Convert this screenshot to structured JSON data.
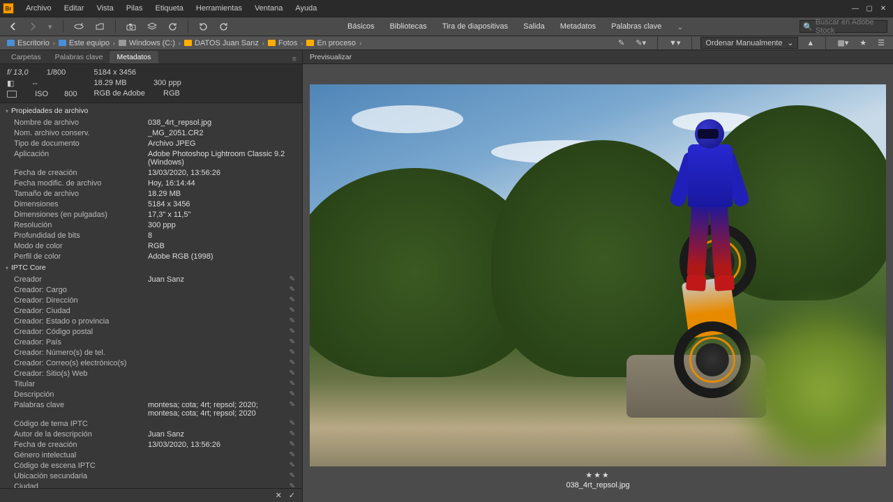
{
  "app_icon_text": "Br",
  "menu": [
    "Archivo",
    "Editar",
    "Vista",
    "Pilas",
    "Etiqueta",
    "Herramientas",
    "Ventana",
    "Ayuda"
  ],
  "toolbar_links": [
    "Básicos",
    "Bibliotecas",
    "Tira de diapositivas",
    "Salida",
    "Metadatos",
    "Palabras clave"
  ],
  "search_placeholder": "Buscar en Adobe Stock",
  "breadcrumb": [
    {
      "icon": "pc",
      "label": "Escritorio"
    },
    {
      "icon": "pc",
      "label": "Este equipo"
    },
    {
      "icon": "drive",
      "label": "Windows (C:)"
    },
    {
      "icon": "folder",
      "label": "DATOS Juan Sanz"
    },
    {
      "icon": "folder",
      "label": "Fotos"
    },
    {
      "icon": "folder",
      "label": "En proceso",
      "last": true
    }
  ],
  "sort_label": "Ordenar Manualmente",
  "panel_tabs": [
    "Carpetas",
    "Palabras clave",
    "Metadatos"
  ],
  "active_panel_tab": 2,
  "preview_label": "Previsualizar",
  "exif": {
    "fstop": "f/ 13,0",
    "shutter": "1/800",
    "ev": "--",
    "iso_label": "ISO",
    "iso": "800",
    "dimensions": "5184 x 3456",
    "filesize": "18.29 MB",
    "ppi": "300 ppp",
    "colorspace": "RGB de Adobe",
    "colormodel": "RGB"
  },
  "sections": {
    "file_props": "Propiedades de archivo",
    "iptc_core": "IPTC Core"
  },
  "file_props": [
    {
      "l": "Nombre de archivo",
      "v": "038_4rt_repsol.jpg"
    },
    {
      "l": "Nom. archivo conserv.",
      "v": "_MG_2051.CR2"
    },
    {
      "l": "Tipo de documento",
      "v": "Archivo JPEG"
    },
    {
      "l": "Aplicación",
      "v": "Adobe Photoshop Lightroom Classic 9.2 (Windows)"
    },
    {
      "l": "Fecha de creación",
      "v": "13/03/2020, 13:56:26"
    },
    {
      "l": "Fecha modific. de archivo",
      "v": "Hoy, 16:14:44"
    },
    {
      "l": "Tamaño de archivo",
      "v": "18.29 MB"
    },
    {
      "l": "Dimensiones",
      "v": "5184 x 3456"
    },
    {
      "l": "Dimensiones (en pulgadas)",
      "v": "17,3\" x 11,5\""
    },
    {
      "l": "Resolución",
      "v": "300 ppp"
    },
    {
      "l": "Profundidad de bits",
      "v": "8"
    },
    {
      "l": "Modo de color",
      "v": "RGB"
    },
    {
      "l": "Perfil de color",
      "v": "Adobe RGB (1998)"
    }
  ],
  "iptc": [
    {
      "l": "Creador",
      "v": "Juan Sanz",
      "p": true
    },
    {
      "l": "Creador: Cargo",
      "v": "",
      "p": true
    },
    {
      "l": "Creador: Dirección",
      "v": "",
      "p": true
    },
    {
      "l": "Creador: Ciudad",
      "v": "",
      "p": true
    },
    {
      "l": "Creador: Estado o provincia",
      "v": "",
      "p": true
    },
    {
      "l": "Creador: Código postal",
      "v": "",
      "p": true
    },
    {
      "l": "Creador: País",
      "v": "",
      "p": true
    },
    {
      "l": "Creador: Número(s) de tel.",
      "v": "",
      "p": true
    },
    {
      "l": "Creador: Correo(s) electrónico(s)",
      "v": "",
      "p": true
    },
    {
      "l": "Creador: Sitio(s) Web",
      "v": "",
      "p": true
    },
    {
      "l": "Titular",
      "v": "",
      "p": true
    },
    {
      "l": "Descripción",
      "v": "",
      "p": true
    },
    {
      "l": "Palabras clave",
      "v": "montesa; cota; 4rt; repsol; 2020; montesa; cota; 4rt; repsol; 2020",
      "p": true
    },
    {
      "l": "Código de tema IPTC",
      "v": "",
      "p": true
    },
    {
      "l": "Autor de la descripción",
      "v": "Juan Sanz",
      "p": true
    },
    {
      "l": "Fecha de creación",
      "v": "13/03/2020, 13:56:26",
      "p": true
    },
    {
      "l": "Género intelectual",
      "v": "",
      "p": true
    },
    {
      "l": "Código de escena IPTC",
      "v": "",
      "p": true
    },
    {
      "l": "Ubicación secundaria",
      "v": "",
      "p": true
    },
    {
      "l": "Ciudad",
      "v": "",
      "p": true
    }
  ],
  "preview_caption": "038_4rt_repsol.jpg",
  "stars": "★★★"
}
